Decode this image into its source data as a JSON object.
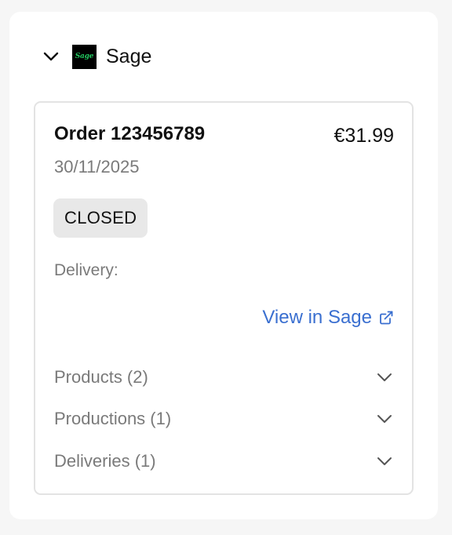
{
  "integration": {
    "name": "Sage",
    "logo_text": "Sage",
    "chevron_icon": "chevron-down-icon",
    "logo_colors": {
      "background": "#000000",
      "text": "#22c55e"
    }
  },
  "order": {
    "title": "Order 123456789",
    "amount": "€31.99",
    "date": "30/11/2025",
    "status": "CLOSED",
    "delivery_label": "Delivery:",
    "view_link_label": "View in Sage",
    "view_link_icon": "external-link-icon",
    "link_color": "#3a6fd0"
  },
  "sections": [
    {
      "label": "Products (2)",
      "icon": "chevron-down-icon"
    },
    {
      "label": "Productions (1)",
      "icon": "chevron-down-icon"
    },
    {
      "label": "Deliveries (1)",
      "icon": "chevron-down-icon"
    }
  ]
}
